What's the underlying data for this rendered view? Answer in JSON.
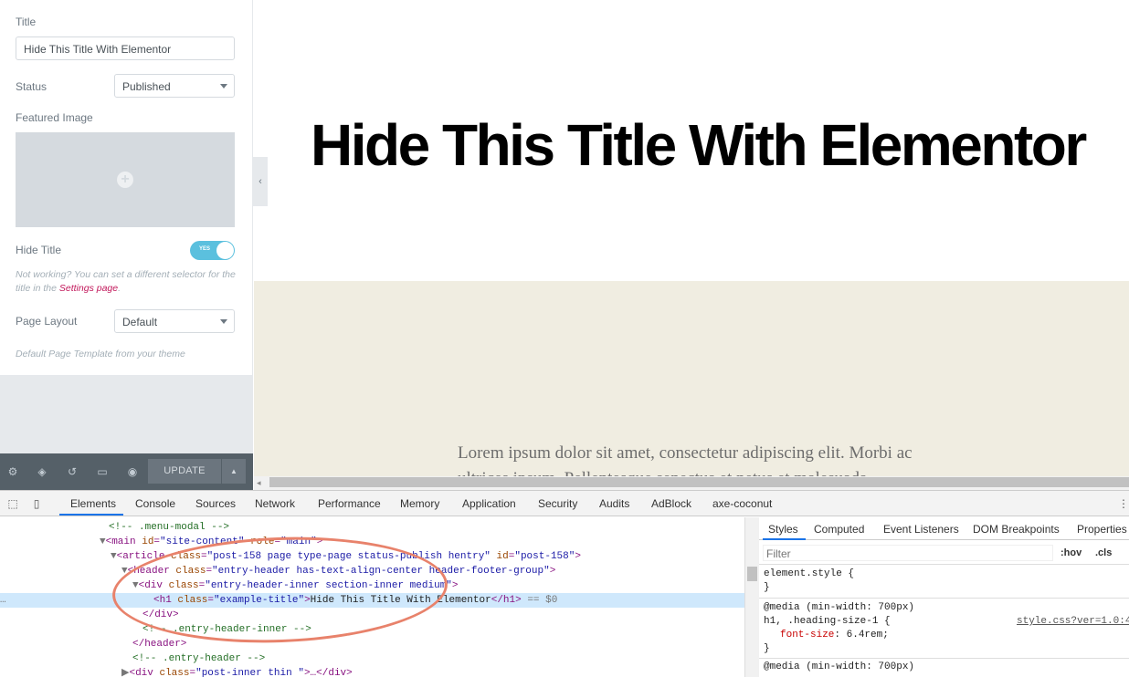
{
  "panel": {
    "title_label": "Title",
    "title_value": "Hide This Title With Elementor",
    "status_label": "Status",
    "status_value": "Published",
    "featured_label": "Featured Image",
    "hide_title_label": "Hide Title",
    "toggle_text": "YES",
    "note_text": "Not working? You can set a different selector for the title in the",
    "note_link": "Settings page",
    "note_end": ".",
    "layout_label": "Page Layout",
    "layout_value": "Default",
    "layout_note": "Default Page Template from your theme"
  },
  "footer": {
    "update_label": "UPDATE"
  },
  "preview": {
    "heading": "Hide This Title With Elementor",
    "lorem": "Lorem ipsum dolor sit amet, consectetur adipiscing elit. Morbi ac ultrices ipsum. Pellentesque senectus et netus et malesuada."
  },
  "devtools": {
    "tabs": [
      "Elements",
      "Console",
      "Sources",
      "Network",
      "Performance",
      "Memory",
      "Application",
      "Security",
      "Audits",
      "AdBlock",
      "axe-coconut"
    ],
    "code": {
      "l1": "<!-- .menu-modal -->",
      "l2a": "<main ",
      "l2b": "id",
      "l2c": "\"site-content\"",
      "l2d": " role",
      "l2e": "\"main\"",
      "l2f": ">",
      "l3a": "<article ",
      "l3b": "class",
      "l3c": "\"post-158 page type-page status-publish hentry\"",
      "l3d": " id",
      "l3e": "\"post-158\"",
      "l3f": ">",
      "l4a": "<header ",
      "l4b": "class",
      "l4c": "\"entry-header has-text-align-center header-footer-group\"",
      "l4d": ">",
      "l5a": "<div ",
      "l5b": "class",
      "l5c": "\"entry-header-inner section-inner medium\"",
      "l5d": ">",
      "l6a": "<h1 ",
      "l6b": "class",
      "l6c": "\"example-title\"",
      "l6d": ">",
      "l6e": "Hide This Title With Elementor",
      "l6f": "</h1>",
      "l6g": " == $0",
      "l7": "</div>",
      "l8": "<!-- .entry-header-inner -->",
      "l9": "</header>",
      "l10": "<!-- .entry-header -->",
      "l11a": "<div ",
      "l11b": "class",
      "l11c": "\"post-inner thin \"",
      "l11d": ">…</div>"
    },
    "styles_tabs": [
      "Styles",
      "Computed",
      "Event Listeners",
      "DOM Breakpoints",
      "Properties"
    ],
    "filter_placeholder": "Filter",
    "hov": ":hov",
    "cls": ".cls",
    "rule1": "element.style {",
    "rule1_end": "}",
    "media1": "@media (min-width: 700px)",
    "selector1": "h1, .heading-size-1 {",
    "source1": "style.css?ver=1.0:4",
    "prop1": "font-size",
    "val1": ": 6.4rem;",
    "rule2_end": "}",
    "media2": "@media (min-width: 700px)"
  },
  "colors": {
    "accent": "#1a73e8",
    "toggle": "#5bc0de",
    "highlight": "#e8826b",
    "beige": "#f0ede1"
  }
}
